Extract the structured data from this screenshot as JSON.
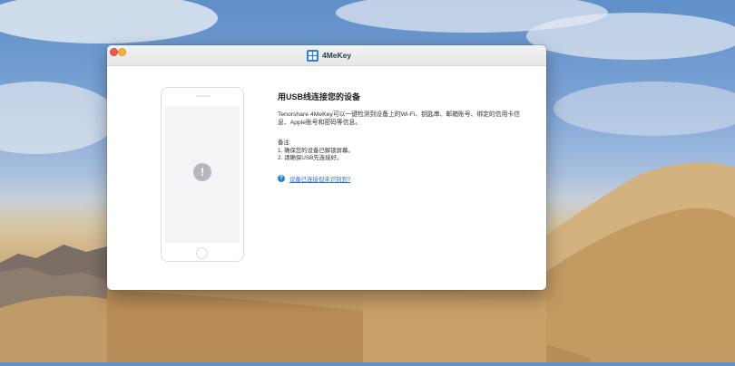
{
  "app": {
    "name": "4MeKey",
    "logo_icon": "grid-logo-icon",
    "accent_color": "#2a83d8"
  },
  "window_controls": {
    "close_icon": "close-traffic-light-icon",
    "minimize_icon": "minimize-traffic-light-icon"
  },
  "device_illustration": {
    "status_icon": "exclamation-alert-icon",
    "status_glyph": "!"
  },
  "main": {
    "title": "用USB线连接您的设备",
    "description": "Tenorshare 4MeKey可以一键检测到设备上的Wi-Fi、钥匙串、邮箱账号、绑定的信用卡信息、Apple账号和密码等信息。",
    "notes_title": "备注:",
    "notes": [
      "1. 确保您的设备已解锁屏幕。",
      "2. 请确保USB先连接好。"
    ],
    "help_icon": "question-circle-icon",
    "help_glyph": "?",
    "help_link": "设备已连接但未识别到?"
  }
}
